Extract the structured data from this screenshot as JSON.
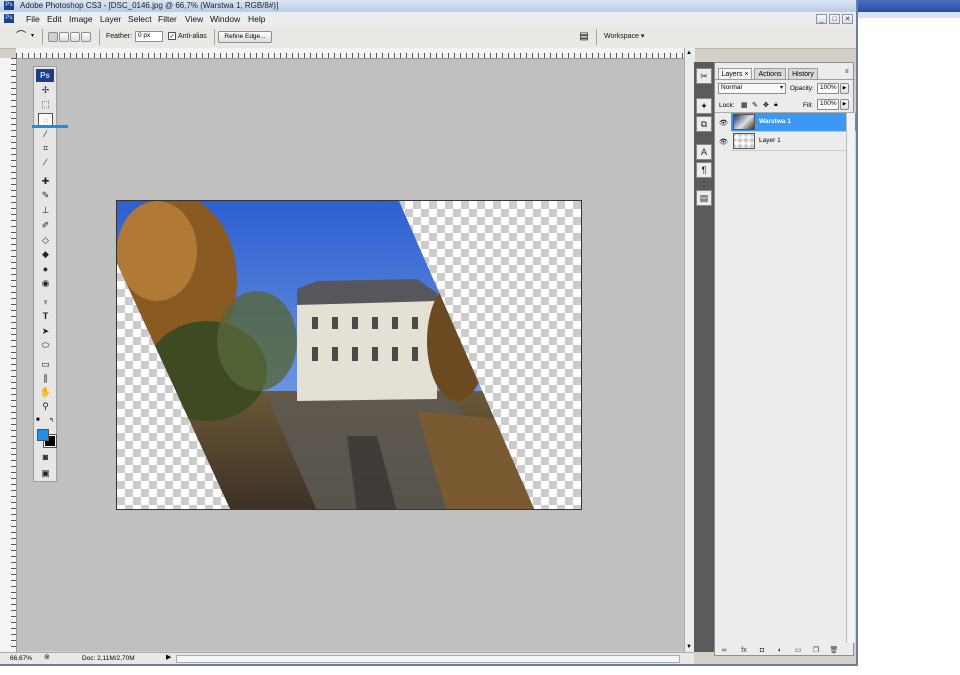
{
  "window": {
    "title": "Adobe Photoshop CS3 - [DSC_0146.jpg @ 66,7% (Warstwa 1, RGB/8#)]",
    "app_icon": "Ps",
    "controls": [
      "_",
      "□",
      "✕"
    ],
    "doc_controls": [
      "_",
      "□",
      "✕"
    ]
  },
  "menu": [
    "File",
    "Edit",
    "Image",
    "Layer",
    "Select",
    "Filter",
    "View",
    "Window",
    "Help"
  ],
  "options_bar": {
    "feather_label": "Feather:",
    "feather_value": "0 px",
    "antialias_label": "Anti-alias",
    "refine_edge_label": "Refine Edge...",
    "workspace_label": "Workspace ▾"
  },
  "toolbox": {
    "logo": "Ps",
    "tools": [
      "move-tool",
      "marquee-tool",
      "lasso-tool",
      "magic-wand-tool",
      "crop-tool",
      "slice-tool",
      "healing-brush-tool",
      "brush-tool",
      "clone-stamp-tool",
      "history-brush-tool",
      "eraser-tool",
      "paint-bucket-tool",
      "blur-tool",
      "dodge-tool",
      "pen-tool",
      "type-tool",
      "path-selection-tool",
      "shape-tool",
      "notes-tool",
      "eyedropper-tool",
      "hand-tool",
      "zoom-tool"
    ],
    "active_tool": "lasso-tool",
    "foreground_color": "#1e90e8",
    "background_color": "#000000"
  },
  "statusbar": {
    "zoom": "66,67%",
    "doc": "Doc: 2,11M/2,70M"
  },
  "layers_panel": {
    "tabs": [
      "Layers ×",
      "Actions",
      "History"
    ],
    "active_tab": 0,
    "blend_mode": "Normal",
    "opacity_label": "Opacity:",
    "opacity_value": "100%",
    "lock_label": "Lock:",
    "fill_label": "Fill:",
    "fill_value": "100%",
    "layers": [
      {
        "name": "Warstwa 1",
        "selected": true,
        "visible": true
      },
      {
        "name": "Layer 1",
        "selected": false,
        "visible": true
      }
    ]
  },
  "colors": {
    "selection_blue": "#3b99f5",
    "workspace_gray": "#c0c0c0",
    "dock_dark": "#5b5b5b"
  }
}
